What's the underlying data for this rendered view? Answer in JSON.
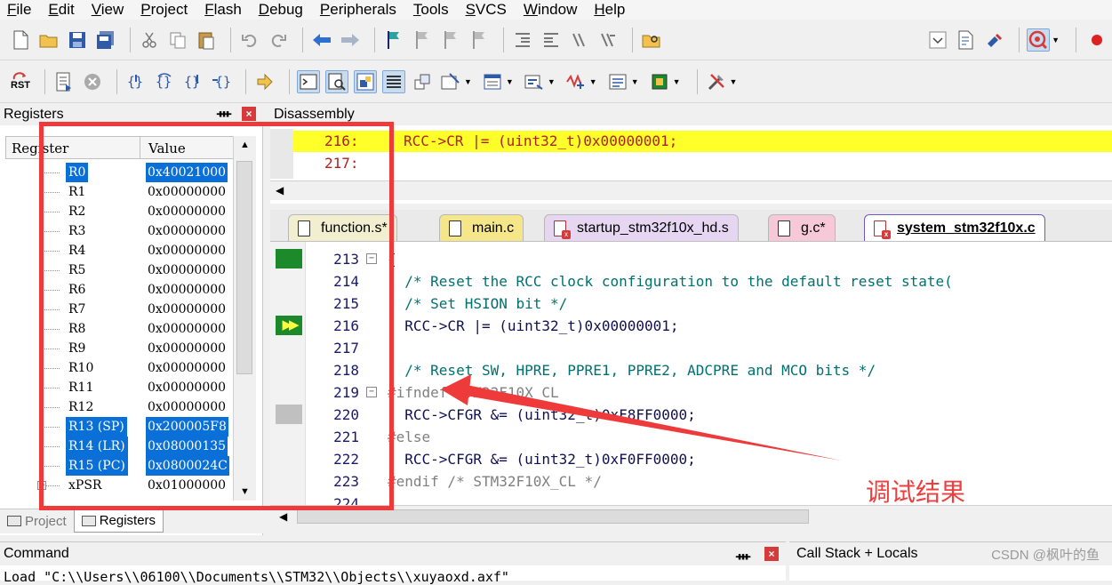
{
  "menu": [
    {
      "label": "File",
      "ul": "F",
      "rest": "ile"
    },
    {
      "label": "Edit",
      "ul": "E",
      "rest": "dit"
    },
    {
      "label": "View",
      "ul": "V",
      "rest": "iew"
    },
    {
      "label": "Project",
      "ul": "P",
      "rest": "roject"
    },
    {
      "label": "Flash",
      "ul": "F",
      "rest": "lash"
    },
    {
      "label": "Debug",
      "ul": "D",
      "rest": "ebug"
    },
    {
      "label": "Peripherals",
      "ul": "P",
      "rest": "eripherals"
    },
    {
      "label": "Tools",
      "ul": "T",
      "rest": "ools"
    },
    {
      "label": "SVCS",
      "ul": "S",
      "rest": "VCS"
    },
    {
      "label": "Window",
      "ul": "W",
      "rest": "indow"
    },
    {
      "label": "Help",
      "ul": "H",
      "rest": "elp"
    }
  ],
  "toolbar": {
    "reset_label": "RST"
  },
  "registers_panel": {
    "title": "Registers",
    "col_register": "Register",
    "col_value": "Value",
    "rows": [
      {
        "name": "R0",
        "value": "0x40021000",
        "selected": true
      },
      {
        "name": "R1",
        "value": "0x00000000",
        "selected": false
      },
      {
        "name": "R2",
        "value": "0x00000000",
        "selected": false
      },
      {
        "name": "R3",
        "value": "0x00000000",
        "selected": false
      },
      {
        "name": "R4",
        "value": "0x00000000",
        "selected": false
      },
      {
        "name": "R5",
        "value": "0x00000000",
        "selected": false
      },
      {
        "name": "R6",
        "value": "0x00000000",
        "selected": false
      },
      {
        "name": "R7",
        "value": "0x00000000",
        "selected": false
      },
      {
        "name": "R8",
        "value": "0x00000000",
        "selected": false
      },
      {
        "name": "R9",
        "value": "0x00000000",
        "selected": false
      },
      {
        "name": "R10",
        "value": "0x00000000",
        "selected": false
      },
      {
        "name": "R11",
        "value": "0x00000000",
        "selected": false
      },
      {
        "name": "R12",
        "value": "0x00000000",
        "selected": false
      },
      {
        "name": "R13 (SP)",
        "value": "0x200005F8",
        "selected": true
      },
      {
        "name": "R14 (LR)",
        "value": "0x08000135",
        "selected": true
      },
      {
        "name": "R15 (PC)",
        "value": "0x0800024C",
        "selected": true
      },
      {
        "name": "xPSR",
        "value": "0x01000000",
        "selected": false,
        "expandable": true
      }
    ],
    "tabs": [
      {
        "label": "Project",
        "active": false
      },
      {
        "label": "Registers",
        "active": true
      }
    ]
  },
  "disassembly": {
    "title": "Disassembly",
    "lines": [
      {
        "lno": "216:",
        "src": "RCC->CR |= (uint32_t)0x00000001;",
        "highlight": true
      },
      {
        "lno": "217:",
        "src": "",
        "highlight": false
      }
    ]
  },
  "file_tabs": [
    {
      "label": "function.s*"
    },
    {
      "label": "main.c"
    },
    {
      "label": "startup_stm32f10x_hd.s"
    },
    {
      "label": "g.c*"
    },
    {
      "label": "system_stm32f10x.c"
    }
  ],
  "editor": {
    "lines": [
      {
        "lno": "213",
        "text": "{",
        "kind": "code",
        "fold": "−",
        "gutter": "green"
      },
      {
        "lno": "214",
        "text": "  /* Reset the RCC clock configuration to the default reset state(",
        "kind": "cmt",
        "fold": "",
        "gutter": ""
      },
      {
        "lno": "215",
        "text": "  /* Set HSION bit */",
        "kind": "cmt",
        "fold": "",
        "gutter": ""
      },
      {
        "lno": "216",
        "text": "  RCC->CR |= (uint32_t)0x00000001;",
        "kind": "code",
        "fold": "",
        "gutter": "arrow"
      },
      {
        "lno": "217",
        "text": "",
        "kind": "code",
        "fold": "",
        "gutter": ""
      },
      {
        "lno": "218",
        "text": "  /* Reset SW, HPRE, PPRE1, PPRE2, ADCPRE and MCO bits */",
        "kind": "cmt",
        "fold": "",
        "gutter": ""
      },
      {
        "lno": "219",
        "text": "#ifndef STM32F10X_CL",
        "kind": "pp",
        "fold": "−",
        "gutter": ""
      },
      {
        "lno": "220",
        "text": "  RCC->CFGR &= (uint32_t)0xF8FF0000;",
        "kind": "code",
        "fold": "",
        "gutter": "gray"
      },
      {
        "lno": "221",
        "text": "#else",
        "kind": "pp",
        "fold": "",
        "gutter": ""
      },
      {
        "lno": "222",
        "text": "  RCC->CFGR &= (uint32_t)0xF0FF0000;",
        "kind": "code",
        "fold": "",
        "gutter": ""
      },
      {
        "lno": "223",
        "text": "#endif /* STM32F10X_CL */",
        "kind": "pp",
        "fold": "",
        "gutter": ""
      },
      {
        "lno": "224",
        "text": "",
        "kind": "code",
        "fold": "",
        "gutter": ""
      }
    ]
  },
  "command_panel": {
    "title": "Command",
    "text": "Load \"C:\\\\Users\\\\06100\\\\Documents\\\\STM32\\\\Objects\\\\xuyaoxd.axf\""
  },
  "callstack_panel": {
    "title": "Call Stack + Locals"
  },
  "watermark": "CSDN @枫叶的鱼",
  "annotation": {
    "label": "调试结果",
    "color": "#ee3a3a"
  },
  "colors": {
    "selection": "#0a6fd6",
    "highlight_line": "#ffff2a",
    "comment": "#007070"
  }
}
